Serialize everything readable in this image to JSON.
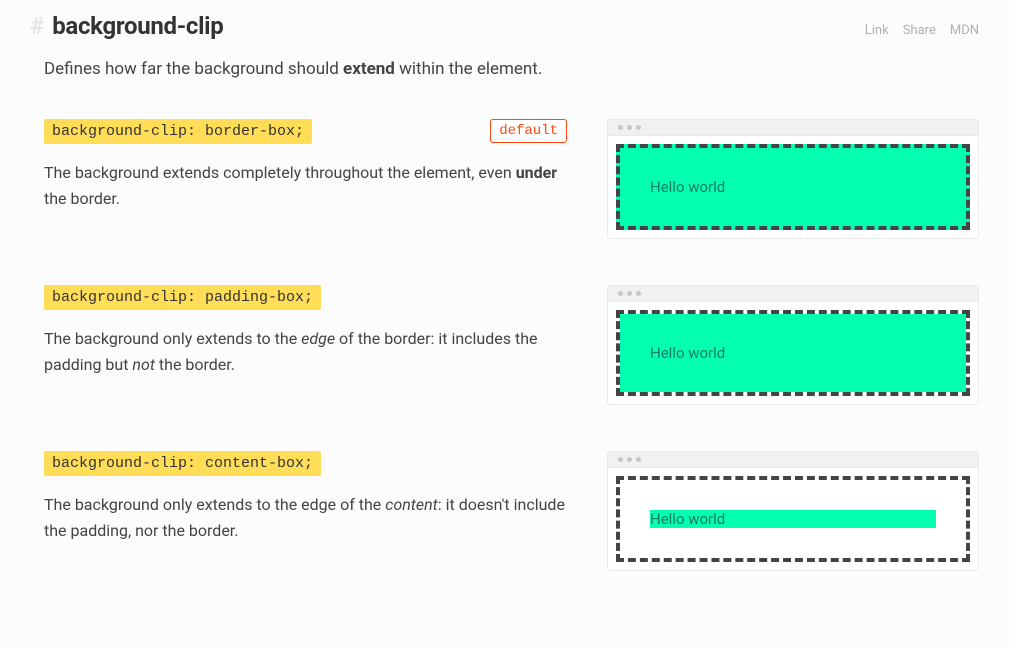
{
  "header": {
    "hash": "#",
    "title": "background-clip",
    "links": {
      "link": "Link",
      "share": "Share",
      "mdn": "MDN"
    }
  },
  "intro": {
    "pre": "Defines how far the background should ",
    "strong": "extend",
    "post": " within the element."
  },
  "examples": [
    {
      "code": "background-clip: border-box;",
      "is_default": true,
      "default_label": "default",
      "desc_parts": {
        "pre": "The background extends completely throughout the element, even ",
        "em": "under",
        "em_style": "bold",
        "post": " the border."
      },
      "demo_text": "Hello world",
      "clip_class": "clip-border"
    },
    {
      "code": "background-clip: padding-box;",
      "is_default": false,
      "desc_parts": {
        "pre": "The background only extends to the ",
        "em": "edge",
        "em_style": "italic",
        "post": " of the border: it includes the padding but ",
        "em2": "not",
        "post2": " the border."
      },
      "demo_text": "Hello world",
      "clip_class": "clip-padding"
    },
    {
      "code": "background-clip: content-box;",
      "is_default": false,
      "desc_parts": {
        "pre": "The background only extends to the edge of the ",
        "em": "content",
        "em_style": "italic",
        "post": ": it doesn't include the padding, nor the border."
      },
      "demo_text": "Hello world",
      "clip_class": "clip-content"
    }
  ]
}
